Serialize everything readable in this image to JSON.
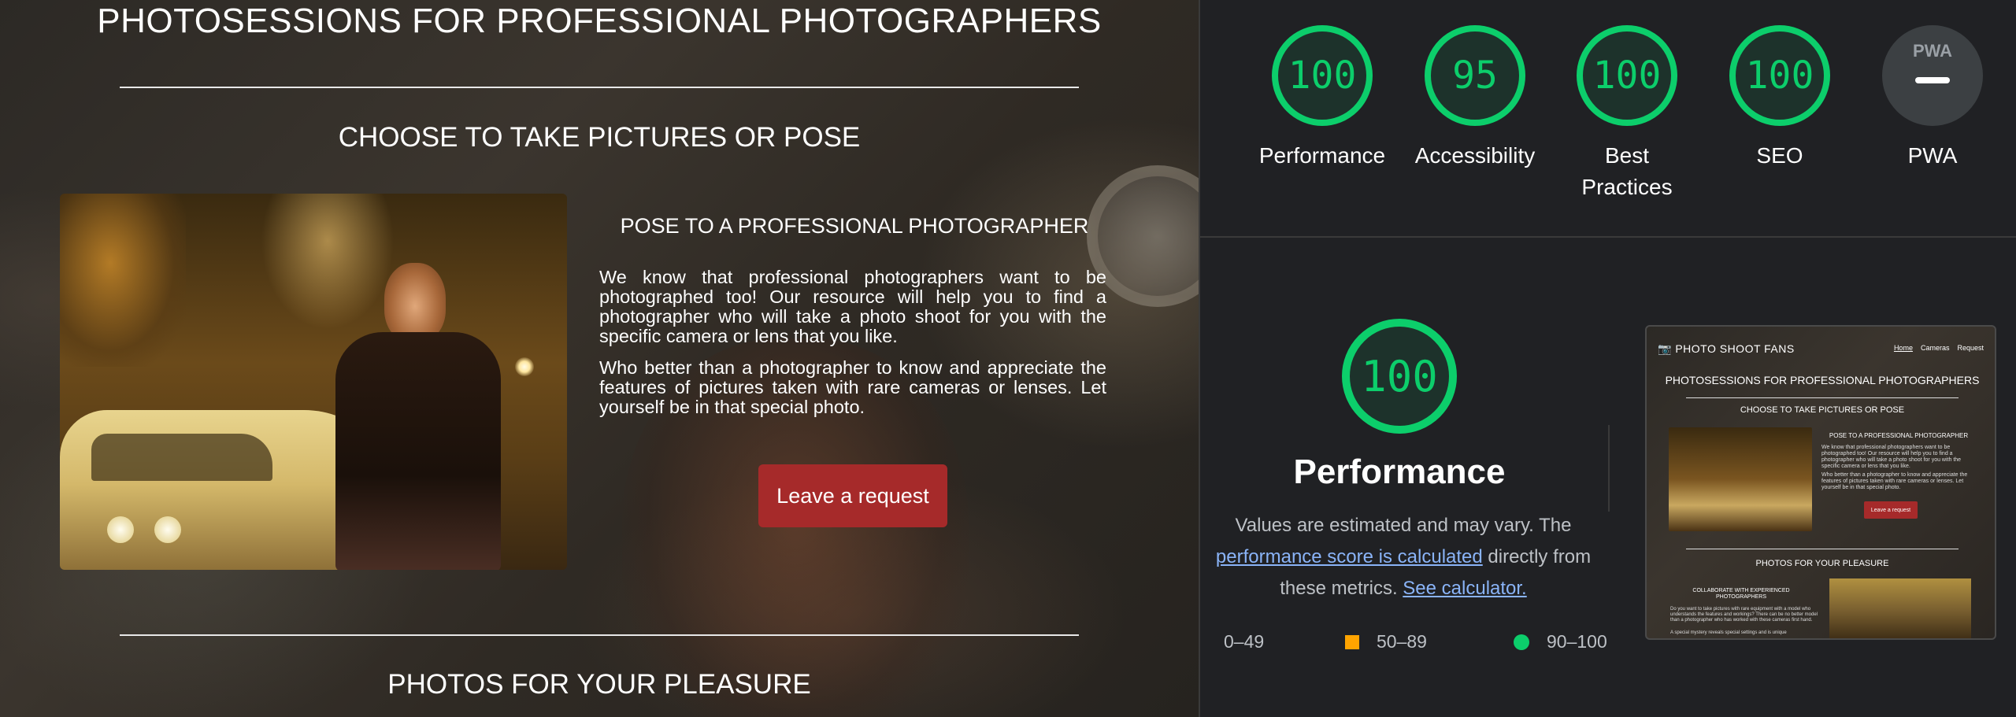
{
  "site": {
    "title": "PHOTOSESSIONS FOR PROFESSIONAL PHOTOGRAPHERS",
    "choose_heading": "CHOOSE TO TAKE PICTURES OR POSE",
    "pose_heading": "POSE TO A PROFESSIONAL PHOTOGRAPHER",
    "paragraph_1": "We know that professional photographers want to be photographed too! Our resource will help you to find a photographer who will take a photo shoot for you with the specific camera or lens that you like.",
    "paragraph_2": "Who better than a photographer to know and appreciate the features of pictures taken with rare cameras or lenses. Let yourself be in that special photo.",
    "request_button": "Leave a request",
    "photos_heading": "PHOTOS FOR YOUR PLEASURE"
  },
  "lighthouse": {
    "scores": [
      {
        "label": "Performance",
        "value": "100"
      },
      {
        "label": "Accessibility",
        "value": "95"
      },
      {
        "label": "Best Practices",
        "value": "100"
      },
      {
        "label": "SEO",
        "value": "100"
      }
    ],
    "pwa": {
      "label": "PWA",
      "badge": "PWA"
    },
    "main_score": "100",
    "main_title": "Performance",
    "desc_prefix": "Values are estimated and may vary. The ",
    "desc_link": "performance score is calculated",
    "desc_middle": " directly from these metrics. ",
    "desc_link2": "See calculator.",
    "legend": [
      {
        "range": "0–49",
        "color": "#ff4e42"
      },
      {
        "range": "50–89",
        "color": "#ffa400"
      },
      {
        "range": "90–100",
        "color": "#0cce6b"
      }
    ],
    "thumbnail": {
      "brand": "📷 PHOTO SHOOT FANS",
      "menu": [
        "Home",
        "Cameras",
        "Request"
      ],
      "title": "PHOTOSESSIONS FOR PROFESSIONAL PHOTOGRAPHERS",
      "choose": "CHOOSE TO TAKE PICTURES OR POSE",
      "pose": "POSE TO A PROFESSIONAL PHOTOGRAPHER",
      "p1": "We know that professional photographers want to be photographed too! Our resource will help you to find a photographer who will take a photo shoot for you with the specific camera or lens that you like.",
      "p2": "Who better than a photographer to know and appreciate the features of pictures taken with rare cameras or lenses. Let yourself be in that special photo.",
      "button": "Leave a request",
      "photos": "PHOTOS FOR YOUR PLEASURE",
      "collab": "COLLABORATE WITH EXPERIENCED PHOTOGRAPHERS",
      "p3": "Do you want to take pictures with rare equipment with a model who understands the features and workings? There can be no better model than a photographer who has worked with these cameras first hand.",
      "p4": "A special mystery reveals special settings and is unique"
    }
  },
  "colors": {
    "good": "#0cce6b",
    "average": "#ffa400",
    "button": "#a62a2a",
    "link": "#8ab4f8"
  }
}
